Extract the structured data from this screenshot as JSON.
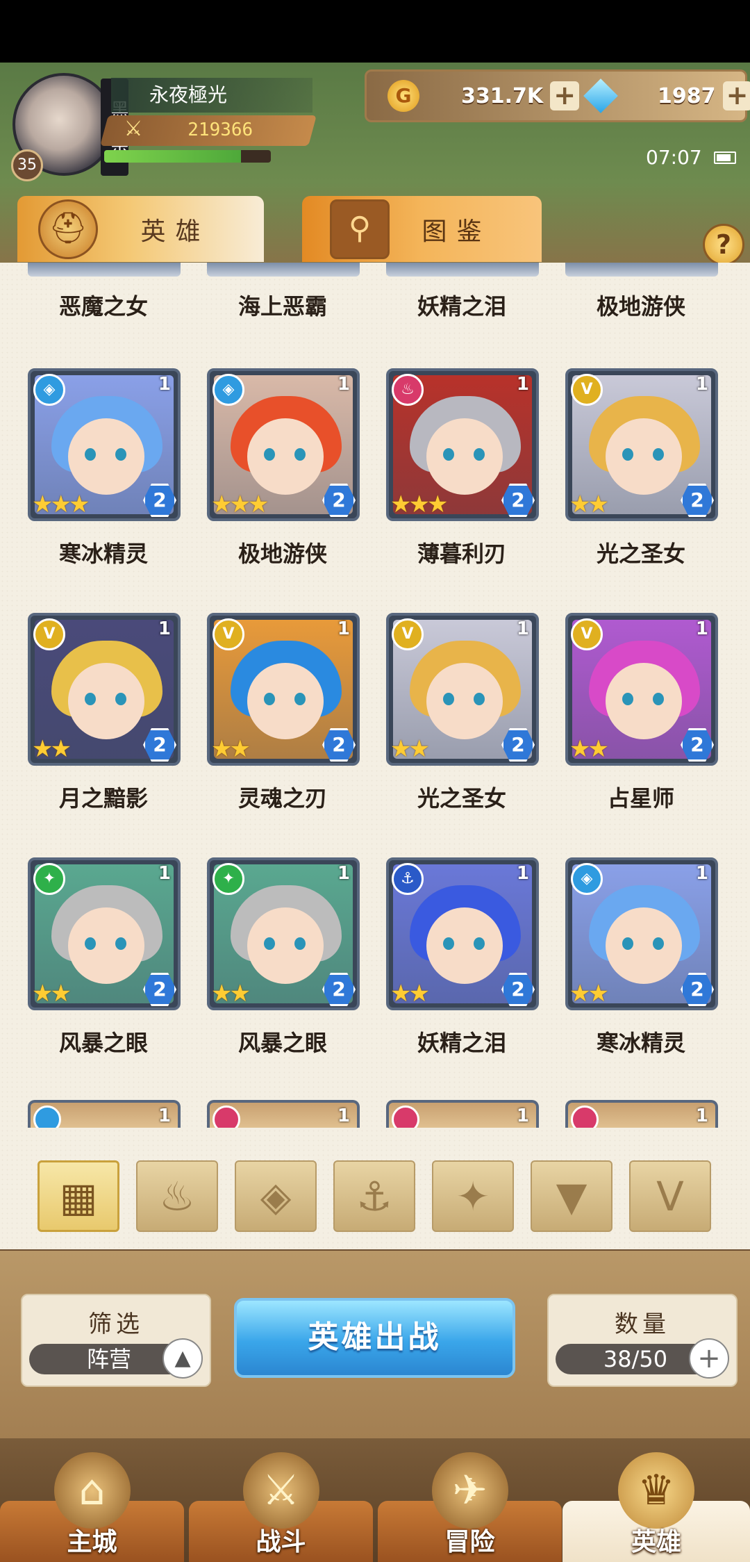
{
  "player": {
    "guild": "黑渦宗",
    "name": "永夜極光",
    "level": "35",
    "power": "219366",
    "exp_fraction": 0.82
  },
  "currency": {
    "gold": "331.7K",
    "gems": "1987",
    "gold_icon": "G"
  },
  "status": {
    "time": "07:07"
  },
  "tabs": {
    "heroes": "英雄",
    "guide": "图鉴",
    "help": "?"
  },
  "top_row_names": [
    "恶魔之女",
    "海上恶霸",
    "妖精之泪",
    "极地游侠"
  ],
  "heroes": [
    {
      "name": "寒冰精灵",
      "faction": "water",
      "faction_glyph": "◈",
      "level": "1",
      "stars": "★★★",
      "tier": "2",
      "hair": "#6aa8f0",
      "bg": "#8aa0e8"
    },
    {
      "name": "极地游侠",
      "faction": "water",
      "faction_glyph": "◈",
      "level": "1",
      "stars": "★★★",
      "tier": "2",
      "hair": "#e8502a",
      "bg": "#d9b9a8"
    },
    {
      "name": "薄暮利刃",
      "faction": "fire",
      "faction_glyph": "♨",
      "level": "1",
      "stars": "★★★",
      "tier": "2",
      "hair": "#b8b8c0",
      "bg": "#b8322a"
    },
    {
      "name": "光之圣女",
      "faction": "light",
      "faction_glyph": "V",
      "level": "1",
      "stars": "★★",
      "tier": "2",
      "hair": "#e8b44a",
      "bg": "#c9c9d8"
    },
    {
      "name": "月之黯影",
      "faction": "light",
      "faction_glyph": "V",
      "level": "1",
      "stars": "★★",
      "tier": "2",
      "hair": "#e8c04a",
      "bg": "#4a4a7a"
    },
    {
      "name": "灵魂之刃",
      "faction": "light",
      "faction_glyph": "V",
      "level": "1",
      "stars": "★★",
      "tier": "2",
      "hair": "#2a8ae0",
      "bg": "#e89a3a"
    },
    {
      "name": "光之圣女",
      "faction": "light",
      "faction_glyph": "V",
      "level": "1",
      "stars": "★★",
      "tier": "2",
      "hair": "#e8b44a",
      "bg": "#c9c9d8"
    },
    {
      "name": "占星师",
      "faction": "light",
      "faction_glyph": "V",
      "level": "1",
      "stars": "★★",
      "tier": "2",
      "hair": "#d84ac8",
      "bg": "#b05ad0"
    },
    {
      "name": "风暴之眼",
      "faction": "beast",
      "faction_glyph": "✦",
      "level": "1",
      "stars": "★★",
      "tier": "2",
      "hair": "#bcbcbc",
      "bg": "#5aa890"
    },
    {
      "name": "风暴之眼",
      "faction": "beast",
      "faction_glyph": "✦",
      "level": "1",
      "stars": "★★",
      "tier": "2",
      "hair": "#bcbcbc",
      "bg": "#5aa890"
    },
    {
      "name": "妖精之泪",
      "faction": "sea",
      "faction_glyph": "⚓",
      "level": "1",
      "stars": "★★",
      "tier": "2",
      "hair": "#3a5ae0",
      "bg": "#6a78d8"
    },
    {
      "name": "寒冰精灵",
      "faction": "water",
      "faction_glyph": "◈",
      "level": "1",
      "stars": "★★",
      "tier": "2",
      "hair": "#6aa8f0",
      "bg": "#8aa0e8"
    }
  ],
  "bottom_row": [
    {
      "faction": "water",
      "level": "1"
    },
    {
      "faction": "fire",
      "level": "1"
    },
    {
      "faction": "fire",
      "level": "1"
    },
    {
      "faction": "fire",
      "level": "1"
    }
  ],
  "faction_colors": {
    "water": "#2f9be0",
    "fire": "#d83a6a",
    "light": "#e0b020",
    "beast": "#2eb04a",
    "sea": "#2a5ac8"
  },
  "filter_buttons": [
    "grid-icon",
    "fire-faction-icon",
    "water-faction-icon",
    "anchor-icon",
    "beast-faction-icon",
    "dark-faction-icon",
    "light-faction-icon"
  ],
  "controls": {
    "filter_title": "筛选",
    "filter_value": "阵营",
    "deploy": "英雄出战",
    "count_title": "数量",
    "count_value": "38/50"
  },
  "nav": [
    "主城",
    "战斗",
    "冒险",
    "英雄"
  ]
}
